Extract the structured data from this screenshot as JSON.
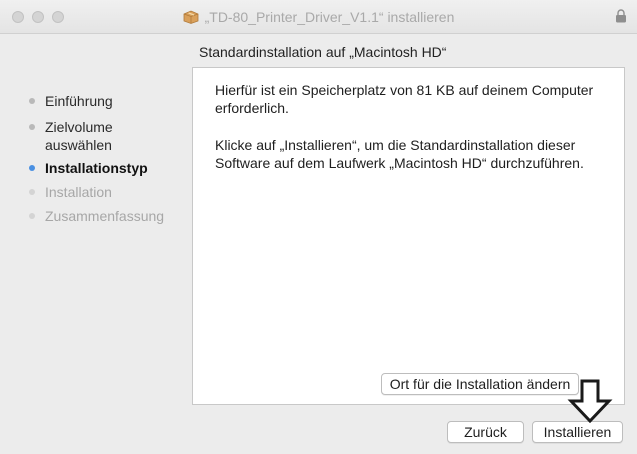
{
  "window": {
    "title": "„TD-80_Printer_Driver_V1.1“ installieren"
  },
  "sidebar": {
    "items": [
      {
        "label": "Einführung",
        "state": "done"
      },
      {
        "label": "Zielvolume auswählen",
        "state": "done"
      },
      {
        "label": "Installationstyp",
        "state": "active"
      },
      {
        "label": "Installation",
        "state": "pending"
      },
      {
        "label": "Zusammenfassung",
        "state": "pending"
      }
    ]
  },
  "content": {
    "header": "Standardinstallation auf „Macintosh HD“",
    "paragraph1": "Hierfür ist ein Speicherplatz von 81 KB auf deinem Computer erforderlich.",
    "paragraph2": "Klicke auf „Installieren“, um die Standardinstallation dieser Software auf dem Laufwerk „Macintosh HD“ durchzuführen.",
    "change_location_button": "Ort für die Installation ändern"
  },
  "footer": {
    "back_button": "Zurück",
    "install_button": "Installieren"
  },
  "colors": {
    "active_dot": "#4a90e2",
    "inactive_dot": "#b9b9b9",
    "window_bg": "#ececec"
  },
  "icons": [
    "package-icon",
    "lock-icon",
    "down-arrow-annotation-icon"
  ]
}
